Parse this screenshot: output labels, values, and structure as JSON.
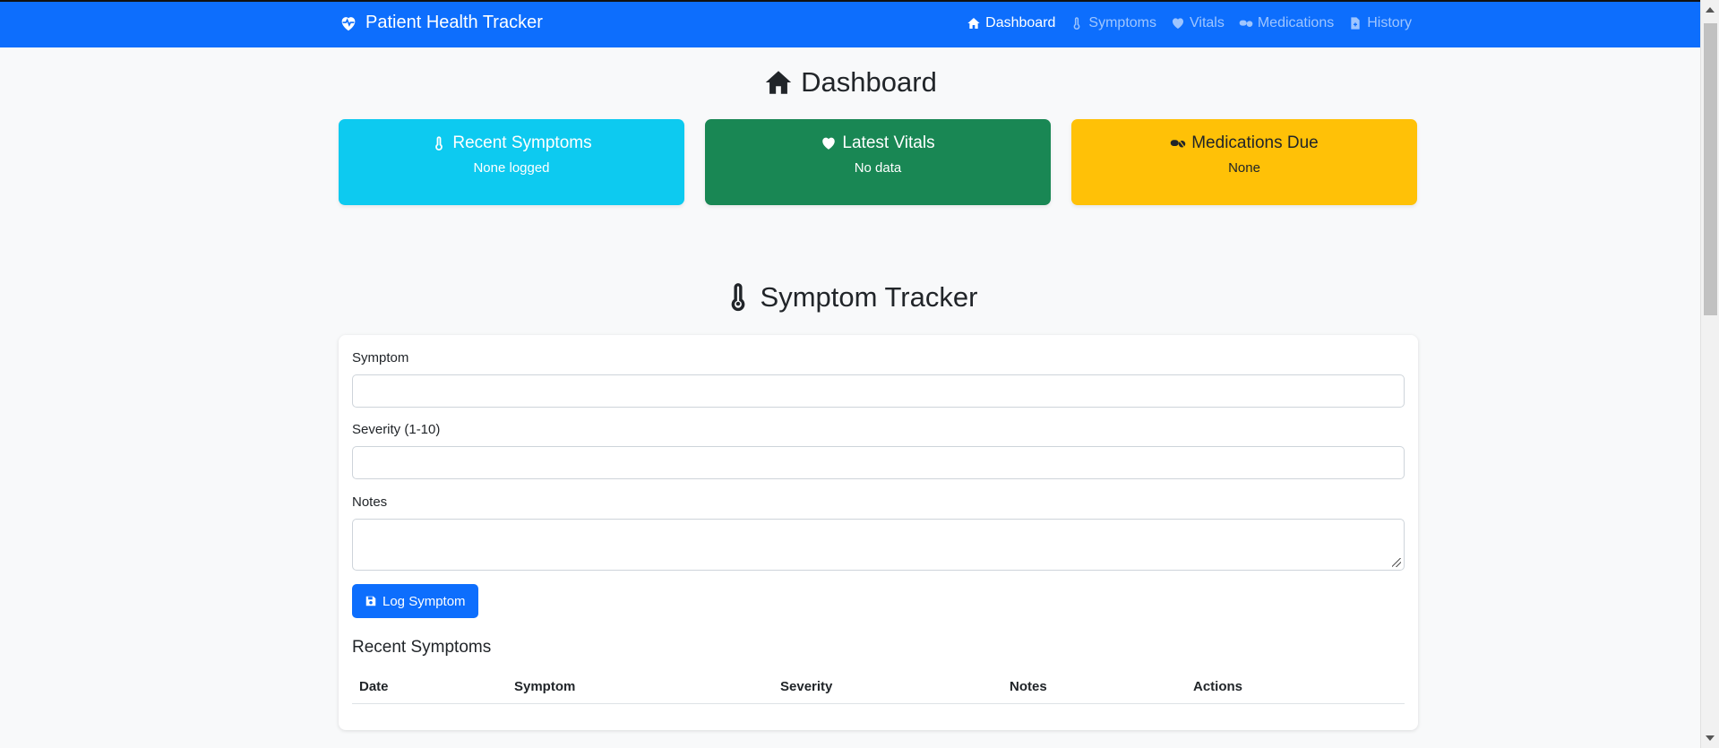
{
  "app": {
    "title": "Patient Health Tracker"
  },
  "nav": {
    "items": [
      {
        "label": "Dashboard",
        "icon": "home-icon",
        "active": true
      },
      {
        "label": "Symptoms",
        "icon": "thermometer-icon",
        "active": false
      },
      {
        "label": "Vitals",
        "icon": "heart-icon",
        "active": false
      },
      {
        "label": "Medications",
        "icon": "pills-icon",
        "active": false
      },
      {
        "label": "History",
        "icon": "file-icon",
        "active": false
      }
    ]
  },
  "dashboard": {
    "title": "Dashboard",
    "cards": [
      {
        "title": "Recent Symptoms",
        "text": "None logged",
        "color": "#0dcaf0",
        "text_color": "#ffffff"
      },
      {
        "title": "Latest Vitals",
        "text": "No data",
        "color": "#198754",
        "text_color": "#ffffff"
      },
      {
        "title": "Medications Due",
        "text": "None",
        "color": "#ffc107",
        "text_color": "#212529"
      }
    ]
  },
  "symptom_tracker": {
    "title": "Symptom Tracker",
    "fields": {
      "symptom_label": "Symptom",
      "symptom_value": "",
      "severity_label": "Severity (1-10)",
      "severity_value": "",
      "notes_label": "Notes",
      "notes_value": ""
    },
    "submit_label": "Log Symptom",
    "recent_title": "Recent Symptoms",
    "columns": [
      "Date",
      "Symptom",
      "Severity",
      "Notes",
      "Actions"
    ]
  },
  "colors": {
    "primary": "#0d6efd",
    "background": "#f8f9fa"
  }
}
